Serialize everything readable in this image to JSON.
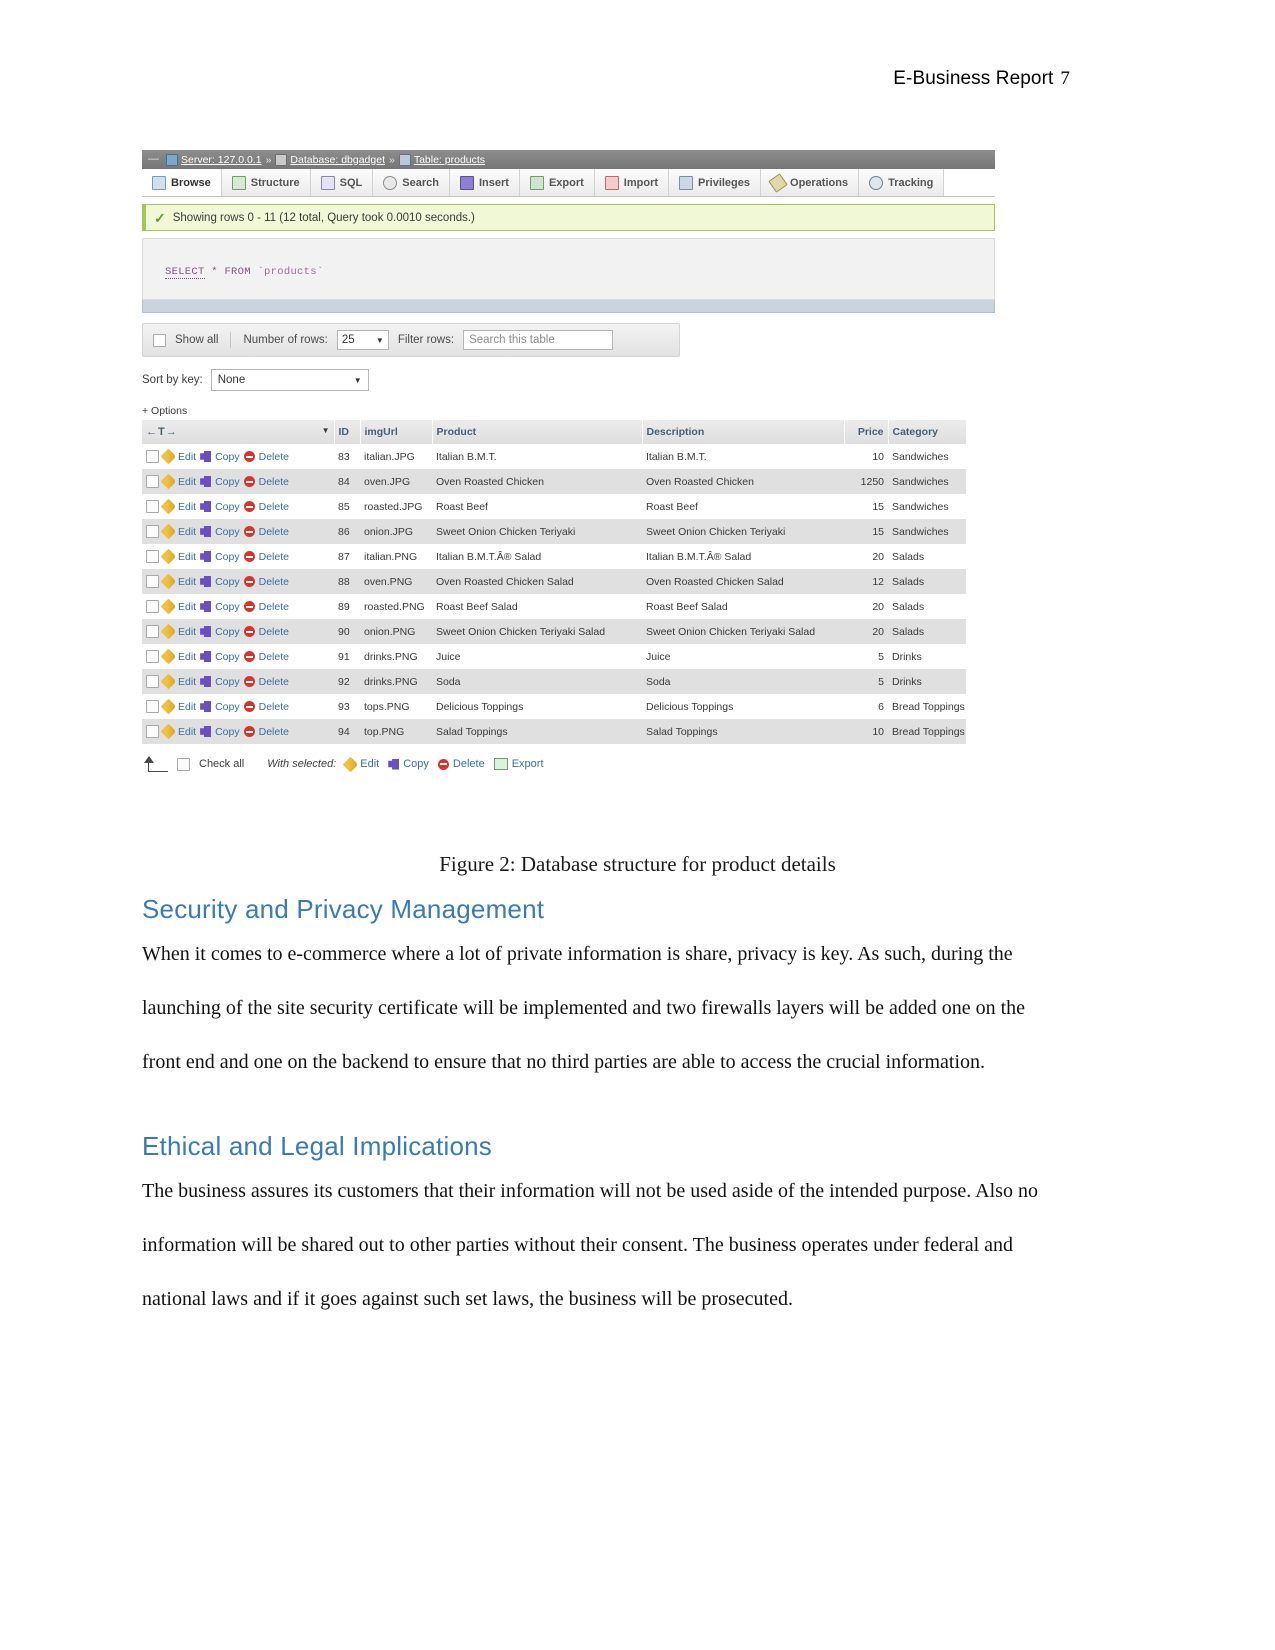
{
  "header": {
    "title": "E-Business Report",
    "page_number": "7"
  },
  "screenshot": {
    "breadcrumb": {
      "collapse_glyph": "—",
      "server_icon": "server-icon",
      "server_label": "Server: 127.0.0.1",
      "sep": "»",
      "db_icon": "database-icon",
      "db_label": "Database: dbgadget",
      "table_icon": "table-icon",
      "table_label": "Table: products"
    },
    "tabs": [
      {
        "label": "Browse",
        "icon": "browse-icon",
        "active": true
      },
      {
        "label": "Structure",
        "icon": "structure-icon",
        "active": false
      },
      {
        "label": "SQL",
        "icon": "sql-icon",
        "active": false
      },
      {
        "label": "Search",
        "icon": "search-icon",
        "active": false
      },
      {
        "label": "Insert",
        "icon": "insert-icon",
        "active": false
      },
      {
        "label": "Export",
        "icon": "export-icon",
        "active": false
      },
      {
        "label": "Import",
        "icon": "import-icon",
        "active": false
      },
      {
        "label": "Privileges",
        "icon": "privileges-icon",
        "active": false
      },
      {
        "label": "Operations",
        "icon": "operations-icon",
        "active": false
      },
      {
        "label": "Tracking",
        "icon": "tracking-icon",
        "active": false
      }
    ],
    "success_message": "Showing rows 0 - 11 (12 total, Query took 0.0010 seconds.)",
    "sql_query": {
      "keyword": "SELECT",
      "star": "*",
      "from": "FROM",
      "object": "`products`"
    },
    "options_bar": {
      "show_all_label": "Show all",
      "number_of_rows_label": "Number of rows:",
      "number_of_rows_value": "25",
      "filter_rows_label": "Filter rows:",
      "filter_placeholder": "Search this table"
    },
    "sort_by_key": {
      "label": "Sort by key:",
      "value": "None"
    },
    "options_link": "+ Options",
    "table": {
      "sort_control": "←T→",
      "columns": [
        "ID",
        "imgUrl",
        "Product",
        "Description",
        "Price",
        "Category"
      ],
      "row_actions": [
        "Edit",
        "Copy",
        "Delete"
      ],
      "rows": [
        {
          "id": "83",
          "imgUrl": "italian.JPG",
          "product": "Italian B.M.T.",
          "description": "Italian B.M.T.",
          "price": "10",
          "category": "Sandwiches"
        },
        {
          "id": "84",
          "imgUrl": "oven.JPG",
          "product": "Oven Roasted Chicken",
          "description": "Oven Roasted Chicken",
          "price": "1250",
          "category": "Sandwiches"
        },
        {
          "id": "85",
          "imgUrl": "roasted.JPG",
          "product": "Roast Beef",
          "description": "Roast Beef",
          "price": "15",
          "category": "Sandwiches"
        },
        {
          "id": "86",
          "imgUrl": "onion.JPG",
          "product": "Sweet Onion Chicken Teriyaki",
          "description": "Sweet Onion Chicken Teriyaki",
          "price": "15",
          "category": "Sandwiches"
        },
        {
          "id": "87",
          "imgUrl": "italian.PNG",
          "product": "Italian B.M.T.Â® Salad",
          "description": "Italian B.M.T.Â® Salad",
          "price": "20",
          "category": "Salads"
        },
        {
          "id": "88",
          "imgUrl": "oven.PNG",
          "product": "Oven Roasted Chicken Salad",
          "description": "Oven Roasted Chicken Salad",
          "price": "12",
          "category": "Salads"
        },
        {
          "id": "89",
          "imgUrl": "roasted.PNG",
          "product": "Roast Beef Salad",
          "description": "Roast Beef Salad",
          "price": "20",
          "category": "Salads"
        },
        {
          "id": "90",
          "imgUrl": "onion.PNG",
          "product": "Sweet Onion Chicken Teriyaki Salad",
          "description": "Sweet Onion Chicken Teriyaki Salad",
          "price": "20",
          "category": "Salads"
        },
        {
          "id": "91",
          "imgUrl": "drinks.PNG",
          "product": "Juice",
          "description": "Juice",
          "price": "5",
          "category": "Drinks"
        },
        {
          "id": "92",
          "imgUrl": "drinks.PNG",
          "product": "Soda",
          "description": "Soda",
          "price": "5",
          "category": "Drinks"
        },
        {
          "id": "93",
          "imgUrl": "tops.PNG",
          "product": "Delicious Toppings",
          "description": "Delicious Toppings",
          "price": "6",
          "category": "Bread Toppings"
        },
        {
          "id": "94",
          "imgUrl": "top.PNG",
          "product": "Salad Toppings",
          "description": "Salad Toppings",
          "price": "10",
          "category": "Bread Toppings"
        }
      ]
    },
    "footer": {
      "check_all_label": "Check all",
      "with_selected_label": "With selected:",
      "actions": [
        "Edit",
        "Copy",
        "Delete",
        "Export"
      ]
    }
  },
  "figure_caption": "Figure 2: Database structure for product details",
  "sections": [
    {
      "heading": "Security and Privacy Management",
      "paragraph": "When it comes to e-commerce where a lot of private information is share, privacy is key. As such, during the launching of the site security certificate will be implemented and two firewalls layers will be added one on the front end and one on the backend to ensure that no third parties are able to access the crucial information."
    },
    {
      "heading": "Ethical and Legal Implications",
      "paragraph": "The business assures its customers that their information will not be used aside of the intended purpose. Also no information will be shared out to other parties without their consent. The business operates under federal and national laws and if it goes against such set laws, the business will be prosecuted."
    }
  ]
}
